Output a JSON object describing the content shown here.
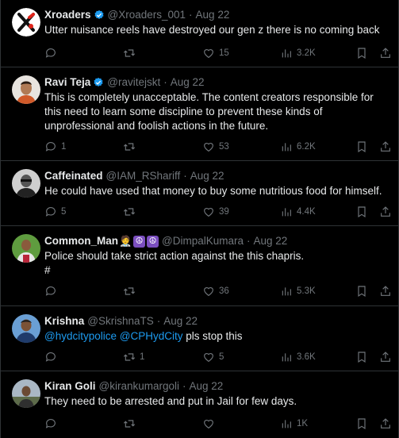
{
  "tweets": [
    {
      "name": "Xroaders",
      "verified": true,
      "handle": "@Xroaders_001",
      "date": "Aug 22",
      "text": "Utter nuisance reels  have destroyed our gen z there is no coming back",
      "replies": "",
      "retweets": "",
      "likes": "15",
      "views": "3.2K",
      "avatar": "x-logo-avatar"
    },
    {
      "name": "Ravi Teja",
      "verified": true,
      "handle": "@ravitejskt",
      "date": "Aug 22",
      "text": "This is completely unacceptable. The content creators responsible for this need to learn some discipline to prevent these kinds of unprofessional and foolish actions in the future.",
      "replies": "1",
      "retweets": "",
      "likes": "53",
      "views": "6.2K",
      "avatar": "man-photo-avatar"
    },
    {
      "name": "Caffeinated",
      "verified": false,
      "handle": "@IAM_RShariff",
      "date": "Aug 22",
      "text": "He could have used that money to buy some nutritious food for himself.",
      "replies": "5",
      "retweets": "",
      "likes": "39",
      "views": "4.4K",
      "avatar": "bw-photo-avatar"
    },
    {
      "name": "Common_Man",
      "verified": false,
      "handle": "@DimpalKumara",
      "date": "Aug 22",
      "text_line1": "Police should take strict action against the this chapris.",
      "text_line2": "#",
      "replies": "",
      "retweets": "",
      "likes": "36",
      "views": "5.3K",
      "avatar": "outdoor-photo-avatar"
    },
    {
      "name": "Krishna",
      "verified": false,
      "handle": "@SkrishnaTS",
      "date": "Aug 22",
      "mention1": "@hydcitypolice",
      "mention2": "@CPHydCity",
      "text_rest": " pls stop this",
      "replies": "",
      "retweets": "1",
      "likes": "5",
      "views": "3.6K",
      "avatar": "blue-photo-avatar"
    },
    {
      "name": "Kiran Goli",
      "verified": false,
      "handle": "@kirankumargoli",
      "date": "Aug 22",
      "text": "They need to be arrested and put in Jail for few days.",
      "replies": "",
      "retweets": "",
      "likes": "",
      "views": "1K",
      "avatar": "landscape-photo-avatar"
    }
  ],
  "separator": "·",
  "emoji": {
    "person": "🧑‍⚕",
    "peace": "☮"
  },
  "colors": {
    "background": "#000000",
    "text": "#e7e9ea",
    "secondary": "#71767b",
    "link": "#1d9bf0",
    "verified": "#1d9bf0",
    "border": "#2f3336"
  }
}
